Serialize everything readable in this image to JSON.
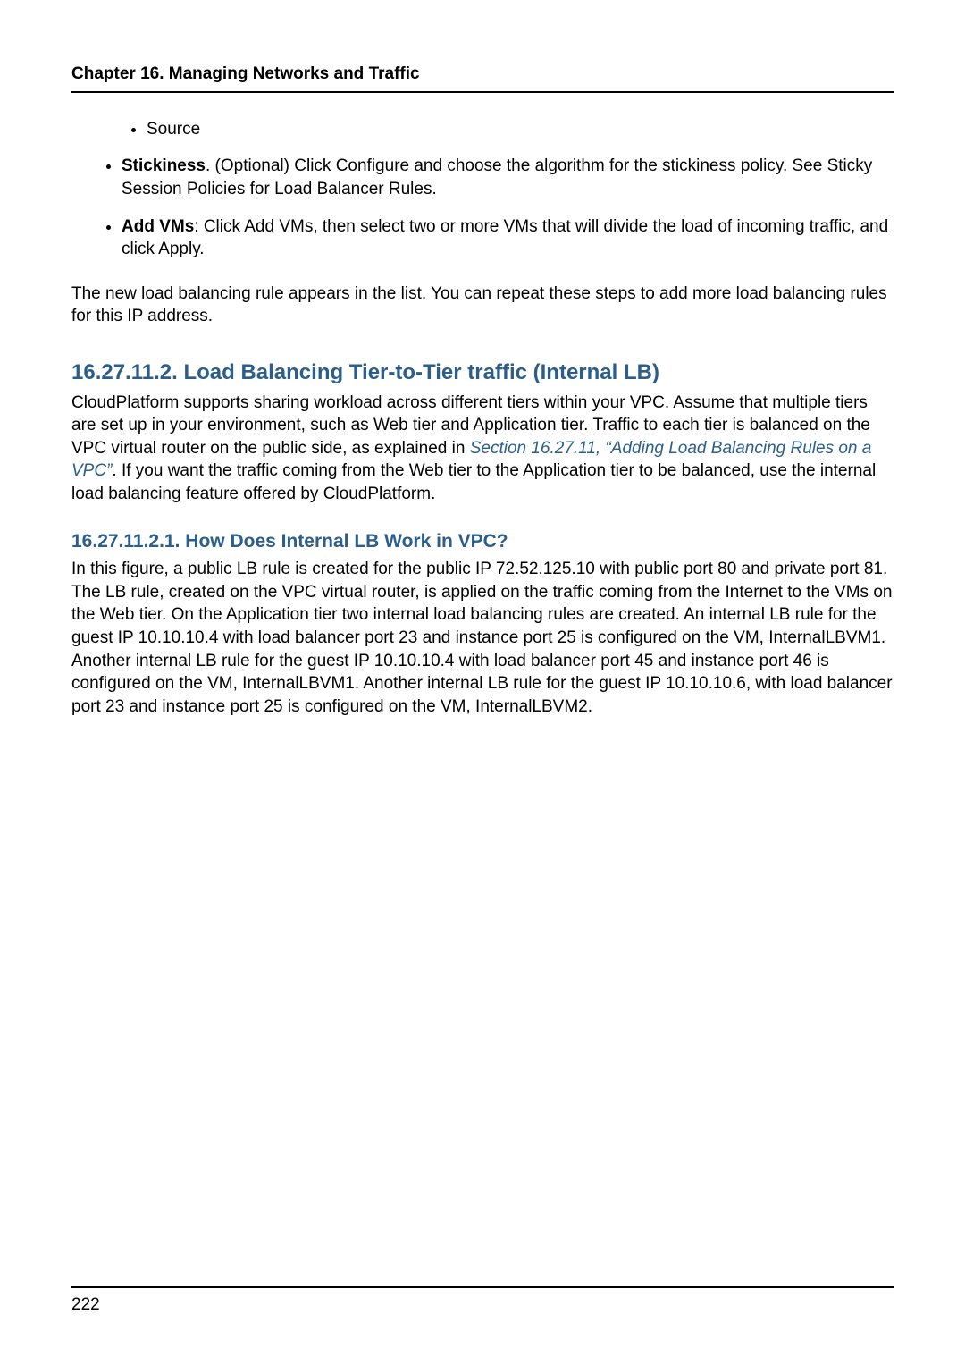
{
  "running_header": "Chapter 16. Managing Networks and Traffic",
  "page_number": "222",
  "list_inner": {
    "items": [
      "Source"
    ]
  },
  "list_outer": {
    "items": [
      {
        "strong": "Stickiness",
        "rest": ". (Optional) Click Configure and choose the algorithm for the stickiness policy. See Sticky Session Policies for Load Balancer Rules."
      },
      {
        "strong": "Add VMs",
        "rest": ": Click Add VMs, then select two or more VMs that will divide the load of incoming traffic, and click Apply."
      }
    ]
  },
  "para_after_list": "The new load balancing rule appears in the list. You can repeat these steps to add more load balancing rules for this IP address.",
  "section": {
    "number": "16.27.11.2.",
    "title": "Load Balancing Tier-to-Tier traffic (Internal LB)",
    "body_before_link": "CloudPlatform supports sharing workload across different tiers within your VPC. Assume that multiple tiers are set up in your environment, such as Web tier and Application tier. Traffic to each tier is balanced on the VPC virtual router on the public side, as explained in ",
    "link_text": "Section 16.27.11, “Adding Load Balancing Rules on a VPC”",
    "body_after_link": ". If you want the traffic coming from the Web tier to the Application tier to be balanced, use the internal load balancing feature offered by CloudPlatform."
  },
  "subsection": {
    "number": "16.27.11.2.1.",
    "title": "How Does Internal LB Work in VPC?",
    "body": "In this figure, a public LB rule is created for the public IP 72.52.125.10 with public port 80 and private port 81. The LB rule, created on the VPC virtual router, is applied on the traffic coming from the Internet to the VMs on the Web tier. On the Application tier two internal load balancing rules are created. An internal LB rule for the guest IP 10.10.10.4 with load balancer port 23 and instance port 25 is configured on the VM, InternalLBVM1. Another internal LB rule for the guest IP 10.10.10.4 with load balancer port 45 and instance port 46 is configured on the VM, InternalLBVM1. Another internal LB rule for the guest IP 10.10.10.6, with load balancer port 23 and instance port 25 is configured on the VM, InternalLBVM2."
  }
}
